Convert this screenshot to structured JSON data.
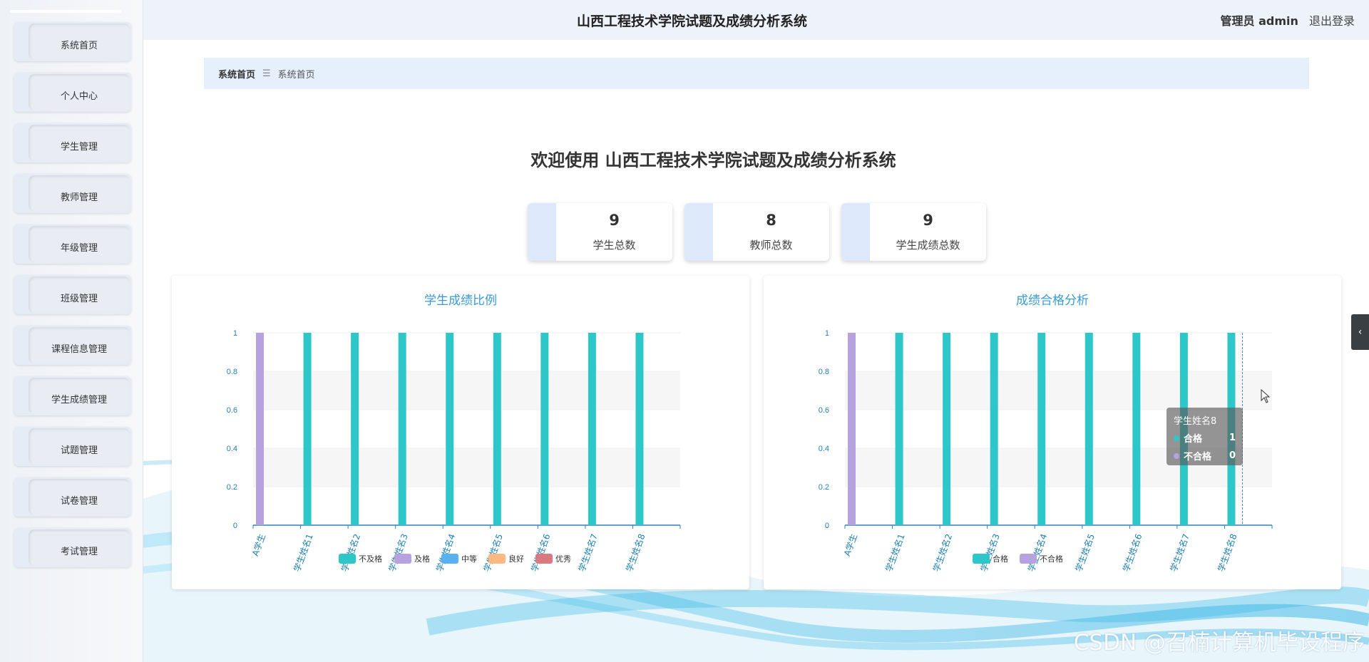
{
  "header": {
    "title": "山西工程技术学院试题及成绩分析系统",
    "user_label": "管理员 admin",
    "logout_label": "退出登录"
  },
  "sidebar": {
    "items": [
      {
        "label": "系统首页"
      },
      {
        "label": "个人中心"
      },
      {
        "label": "学生管理"
      },
      {
        "label": "教师管理"
      },
      {
        "label": "年级管理"
      },
      {
        "label": "班级管理"
      },
      {
        "label": "课程信息管理"
      },
      {
        "label": "学生成绩管理"
      },
      {
        "label": "试题管理"
      },
      {
        "label": "试卷管理"
      },
      {
        "label": "考试管理"
      }
    ]
  },
  "breadcrumb": {
    "home": "系统首页",
    "separator_icon": "menu-icon",
    "current": "系统首页"
  },
  "welcome": "欢迎使用 山西工程技术学院试题及成绩分析系统",
  "stats": [
    {
      "value": "9",
      "label": "学生总数"
    },
    {
      "value": "8",
      "label": "教师总数"
    },
    {
      "value": "9",
      "label": "学生成绩总数"
    }
  ],
  "chart_data": [
    {
      "type": "bar",
      "title": "学生成绩比例",
      "categories": [
        "A学生",
        "学生姓名1",
        "学生姓名2",
        "学生姓名3",
        "学生姓名4",
        "学生姓名5",
        "学生姓名6",
        "学生姓名7",
        "学生姓名8"
      ],
      "series": [
        {
          "name": "不及格",
          "color": "#2ec7c9",
          "values": [
            0,
            1,
            1,
            1,
            1,
            1,
            1,
            1,
            1
          ]
        },
        {
          "name": "及格",
          "color": "#b6a2de",
          "values": [
            1,
            0,
            0,
            0,
            0,
            0,
            0,
            0,
            0
          ]
        },
        {
          "name": "中等",
          "color": "#5ab1ef",
          "values": [
            0,
            0,
            0,
            0,
            0,
            0,
            0,
            0,
            0
          ]
        },
        {
          "name": "良好",
          "color": "#ffb980",
          "values": [
            0,
            0,
            0,
            0,
            0,
            0,
            0,
            0,
            0
          ]
        },
        {
          "name": "优秀",
          "color": "#d87a80",
          "values": [
            0,
            0,
            0,
            0,
            0,
            0,
            0,
            0,
            0
          ]
        }
      ],
      "ylim": [
        0,
        1
      ],
      "yticks": [
        "0",
        "0.2",
        "0.4",
        "0.6",
        "0.8",
        "1"
      ],
      "grid": true,
      "legend": "bottom"
    },
    {
      "type": "bar",
      "title": "成绩合格分析",
      "categories": [
        "A学生",
        "学生姓名1",
        "学生姓名2",
        "学生姓名3",
        "学生姓名4",
        "学生姓名5",
        "学生姓名6",
        "学生姓名7",
        "学生姓名8"
      ],
      "series": [
        {
          "name": "合格",
          "color": "#2ec7c9",
          "values": [
            0,
            1,
            1,
            1,
            1,
            1,
            1,
            1,
            1
          ]
        },
        {
          "name": "不合格",
          "color": "#b6a2de",
          "values": [
            1,
            0,
            0,
            0,
            0,
            0,
            0,
            0,
            0
          ]
        }
      ],
      "ylim": [
        0,
        1
      ],
      "yticks": [
        "0",
        "0.2",
        "0.4",
        "0.6",
        "0.8",
        "1"
      ],
      "grid": true,
      "legend": "bottom"
    }
  ],
  "tooltip": {
    "title": "学生姓名8",
    "rows": [
      {
        "name": "合格",
        "value": "1",
        "color": "#2ec7c9"
      },
      {
        "name": "不合格",
        "value": "0",
        "color": "#b6a2de"
      }
    ]
  },
  "side_tab_icon": "chevron-left-icon",
  "watermark": "CSDN @召楠计算机毕设程序"
}
